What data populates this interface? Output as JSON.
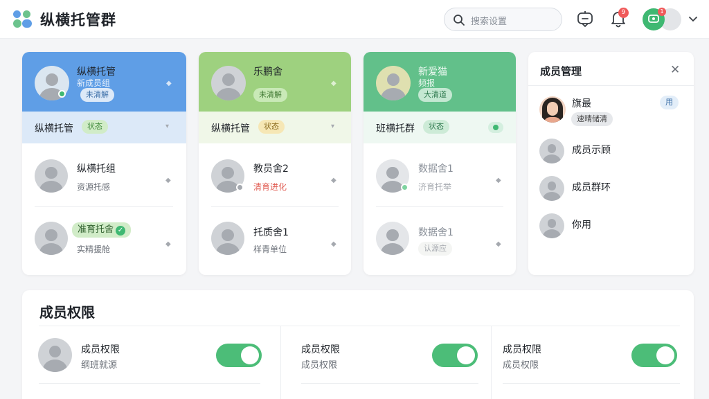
{
  "app": {
    "title": "纵横托管群"
  },
  "search": {
    "placeholder": "搜索设置"
  },
  "header": {
    "notification_count": "9",
    "profile_badge": "1"
  },
  "cards": [
    {
      "top": {
        "name": "纵横托管",
        "sub": "新成员组",
        "tag": "未清解"
      },
      "strip": {
        "label": "纵横托管",
        "status": "状态"
      },
      "items": [
        {
          "name": "纵横托组",
          "sub": "资源托感"
        },
        {
          "name": "准育托舍",
          "sub": "实精援舱"
        }
      ]
    },
    {
      "top": {
        "name": "乐鹏舍",
        "tag": "未清解"
      },
      "strip": {
        "label": "纵横托管",
        "status": "状态"
      },
      "items": [
        {
          "name": "教员舍2",
          "sub": "清育进化"
        },
        {
          "name": "托质舍1",
          "sub": "样青单位"
        }
      ]
    },
    {
      "top": {
        "name": "新爱猫",
        "sub": "频报",
        "tag": "大清道"
      },
      "strip": {
        "label": "班横托群",
        "status": "状态"
      },
      "items": [
        {
          "name": "数据舍1",
          "sub": "济育托举"
        },
        {
          "name": "数据舍1",
          "sub": "认源应"
        }
      ]
    }
  ],
  "member_panel": {
    "title": "成员管理",
    "close": "✕",
    "first": {
      "name": "旗最",
      "tag": "速晴储清",
      "action": "用"
    },
    "items": [
      "成员示顾",
      "成员群环",
      "你用"
    ]
  },
  "permissions": {
    "title": "成员权限",
    "cols": [
      {
        "title": "成员权限",
        "sub": "纲班就源",
        "enabled": true
      },
      {
        "title": "成员权限",
        "sub": "成员权限",
        "enabled": true
      },
      {
        "title": "成员权限",
        "sub": "成员权限",
        "enabled": true
      }
    ]
  },
  "colors": {
    "blue": "#5f9ee6",
    "green_light": "#9ed17f",
    "green": "#62c08a",
    "toggle_on": "#4cbd78",
    "badge_red": "#f05a5a",
    "warn_red": "#e05a50"
  }
}
